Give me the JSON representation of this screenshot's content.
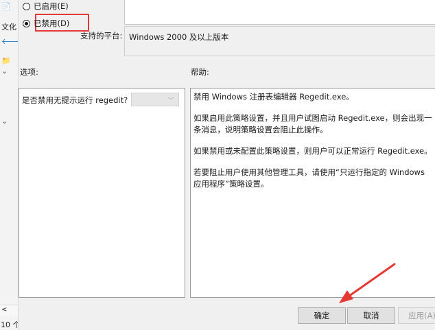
{
  "background": {
    "items": [
      "文化",
      "10 个"
    ]
  },
  "dialog": {
    "radio_enabled": "已启用(E)",
    "radio_disabled": "已禁用(D)",
    "supported_label": "支持的平台:",
    "supported_value": "Windows 2000 及以上版本",
    "options_label": "选项:",
    "help_label": "帮助:",
    "option_question": "是否禁用无提示运行 regedit?",
    "help_paragraphs": [
      "禁用 Windows 注册表编辑器 Regedit.exe。",
      "如果启用此策略设置，并且用户试图启动 Regedit.exe，则会出现一条消息，说明策略设置会阻止此操作。",
      "如果禁用或未配置此策略设置，则用户可以正常运行 Regedit.exe。",
      "若要阻止用户使用其他管理工具，请使用“只运行指定的 Windows 应用程序”策略设置。"
    ],
    "buttons": {
      "ok": "确定",
      "cancel": "取消",
      "apply": "应用(A)"
    }
  },
  "colors": {
    "highlight": "#e53935",
    "arrow": "#e53935"
  }
}
